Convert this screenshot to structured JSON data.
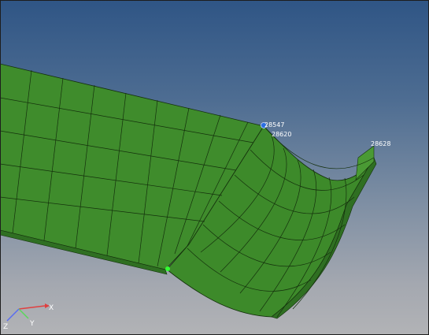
{
  "viewport": {
    "background_top": "#2f5585",
    "background_bottom": "#b2b3b6"
  },
  "mesh": {
    "fill_color": "#3f8c2c",
    "face_color_dark": "#2f6f22",
    "edge_color": "#14300c"
  },
  "node_labels": {
    "n1": "28547",
    "n2": "28620",
    "n3": "28628"
  },
  "markers": {
    "selected_node_color": "#2a6de0",
    "node_marker_color": "#33ff33"
  },
  "triad": {
    "x_label": "X",
    "y_label": "Y",
    "z_label": "Z",
    "x_color": "#e04040",
    "y_color": "#5ad85a",
    "z_color": "#5a6df0"
  }
}
